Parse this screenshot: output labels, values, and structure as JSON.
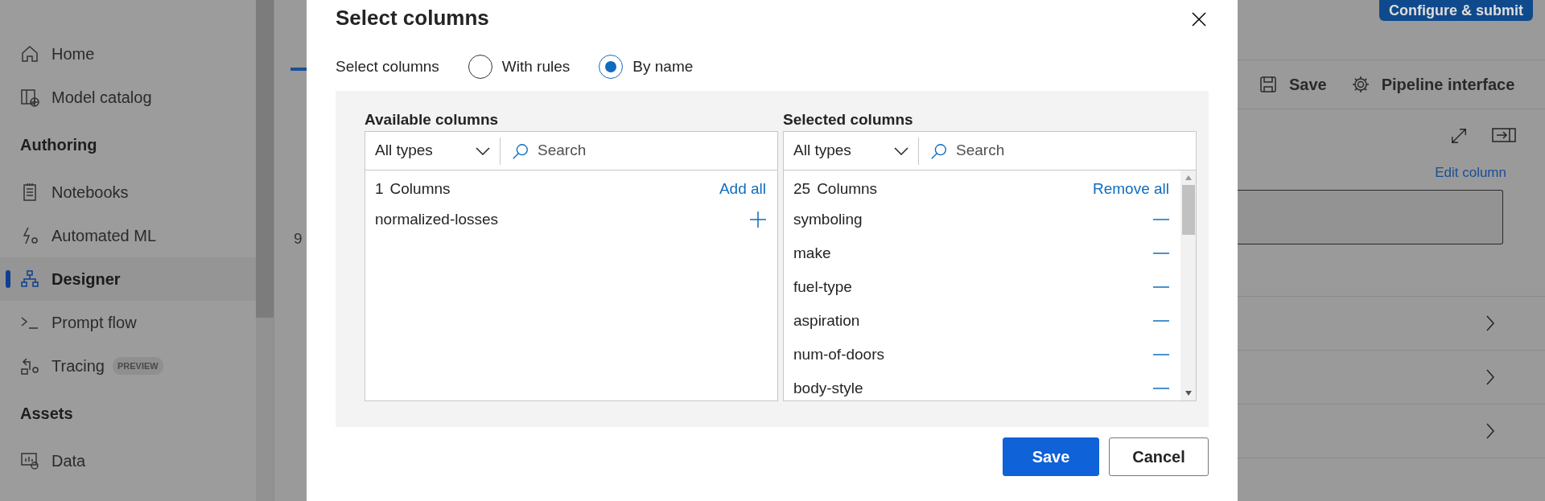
{
  "sidebar": {
    "items": [
      {
        "kind": "item",
        "label": "Home",
        "selected": false
      },
      {
        "kind": "item",
        "label": "Model catalog",
        "selected": false
      },
      {
        "kind": "heading",
        "label": "Authoring"
      },
      {
        "kind": "item",
        "label": "Notebooks",
        "selected": false
      },
      {
        "kind": "item",
        "label": "Automated ML",
        "selected": false
      },
      {
        "kind": "item",
        "label": "Designer",
        "selected": true
      },
      {
        "kind": "item",
        "label": "Prompt flow",
        "selected": false
      },
      {
        "kind": "item",
        "label": "Tracing",
        "badge": "PREVIEW",
        "selected": false
      },
      {
        "kind": "heading",
        "label": "Assets"
      },
      {
        "kind": "item",
        "label": "Data",
        "selected": false
      }
    ]
  },
  "background": {
    "count_fragment": "9",
    "submit_button": "Configure & submit",
    "toolbar": [
      {
        "label": "Save"
      },
      {
        "label": "Pipeline interface"
      }
    ],
    "edit_link": "Edit column"
  },
  "dialog": {
    "title": "Select columns",
    "mode_label": "Select columns",
    "modes": [
      {
        "label": "With rules",
        "selected": false
      },
      {
        "label": "By name",
        "selected": true
      }
    ],
    "lists": [
      {
        "heading": "Available columns",
        "type_filter": "All types",
        "search": {
          "placeholder": "Search"
        },
        "count": "1",
        "count_label": "Columns",
        "action": "Add all",
        "items": [
          "normalized-losses"
        ]
      },
      {
        "heading": "Selected columns",
        "type_filter": "All types",
        "search": {
          "placeholder": "Search"
        },
        "count": "25",
        "count_label": "Columns",
        "action": "Remove all",
        "items": [
          "symboling",
          "make",
          "fuel-type",
          "aspiration",
          "num-of-doors",
          "body-style"
        ]
      }
    ],
    "buttons": [
      "Save",
      "Cancel"
    ]
  }
}
